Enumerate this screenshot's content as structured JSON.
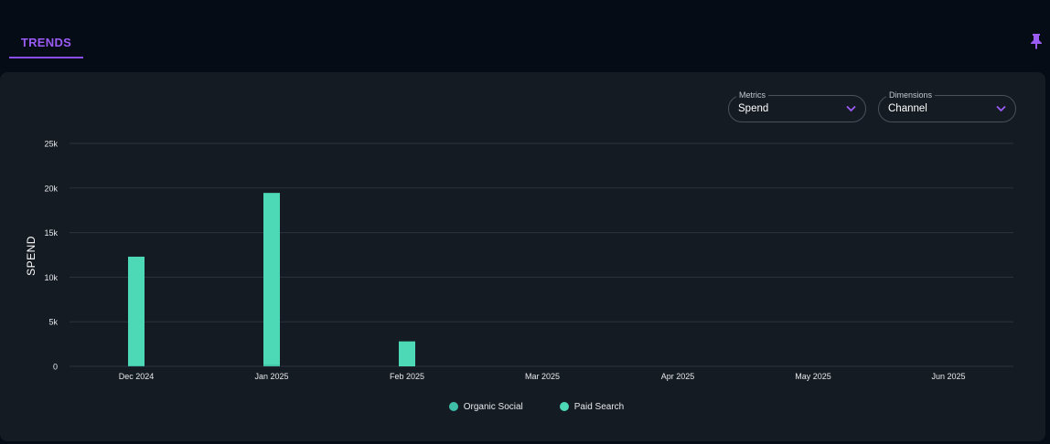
{
  "tabs": [
    {
      "label": "TRENDS",
      "active": true
    }
  ],
  "controls": {
    "metrics": {
      "label": "Metrics",
      "value": "Spend"
    },
    "dimensions": {
      "label": "Dimensions",
      "value": "Channel"
    }
  },
  "colors": {
    "accent": "#9b5cf6",
    "organic_social": "#3fbfa8",
    "paid_search": "#4dd9b5"
  },
  "icons": {
    "pin": "pin-icon",
    "chevron": "chevron-down-icon"
  },
  "chart_data": {
    "type": "bar",
    "stacked": true,
    "categories": [
      "Dec 2024",
      "Jan 2025",
      "Feb 2025",
      "Mar 2025",
      "Apr 2025",
      "May 2025",
      "Jun 2025"
    ],
    "series": [
      {
        "name": "Organic Social",
        "values": [
          100,
          150,
          0,
          0,
          0,
          0,
          0
        ]
      },
      {
        "name": "Paid Search",
        "values": [
          12200,
          19300,
          2800,
          0,
          0,
          0,
          0
        ]
      }
    ],
    "ylabel": "SPEND",
    "xlabel": "",
    "ylim": [
      0,
      25000
    ],
    "yticks": [
      0,
      5000,
      10000,
      15000,
      20000,
      25000
    ],
    "ytick_labels": [
      "0",
      "5k",
      "10k",
      "15k",
      "20k",
      "25k"
    ],
    "grid": true,
    "legend": "bottom-center"
  }
}
